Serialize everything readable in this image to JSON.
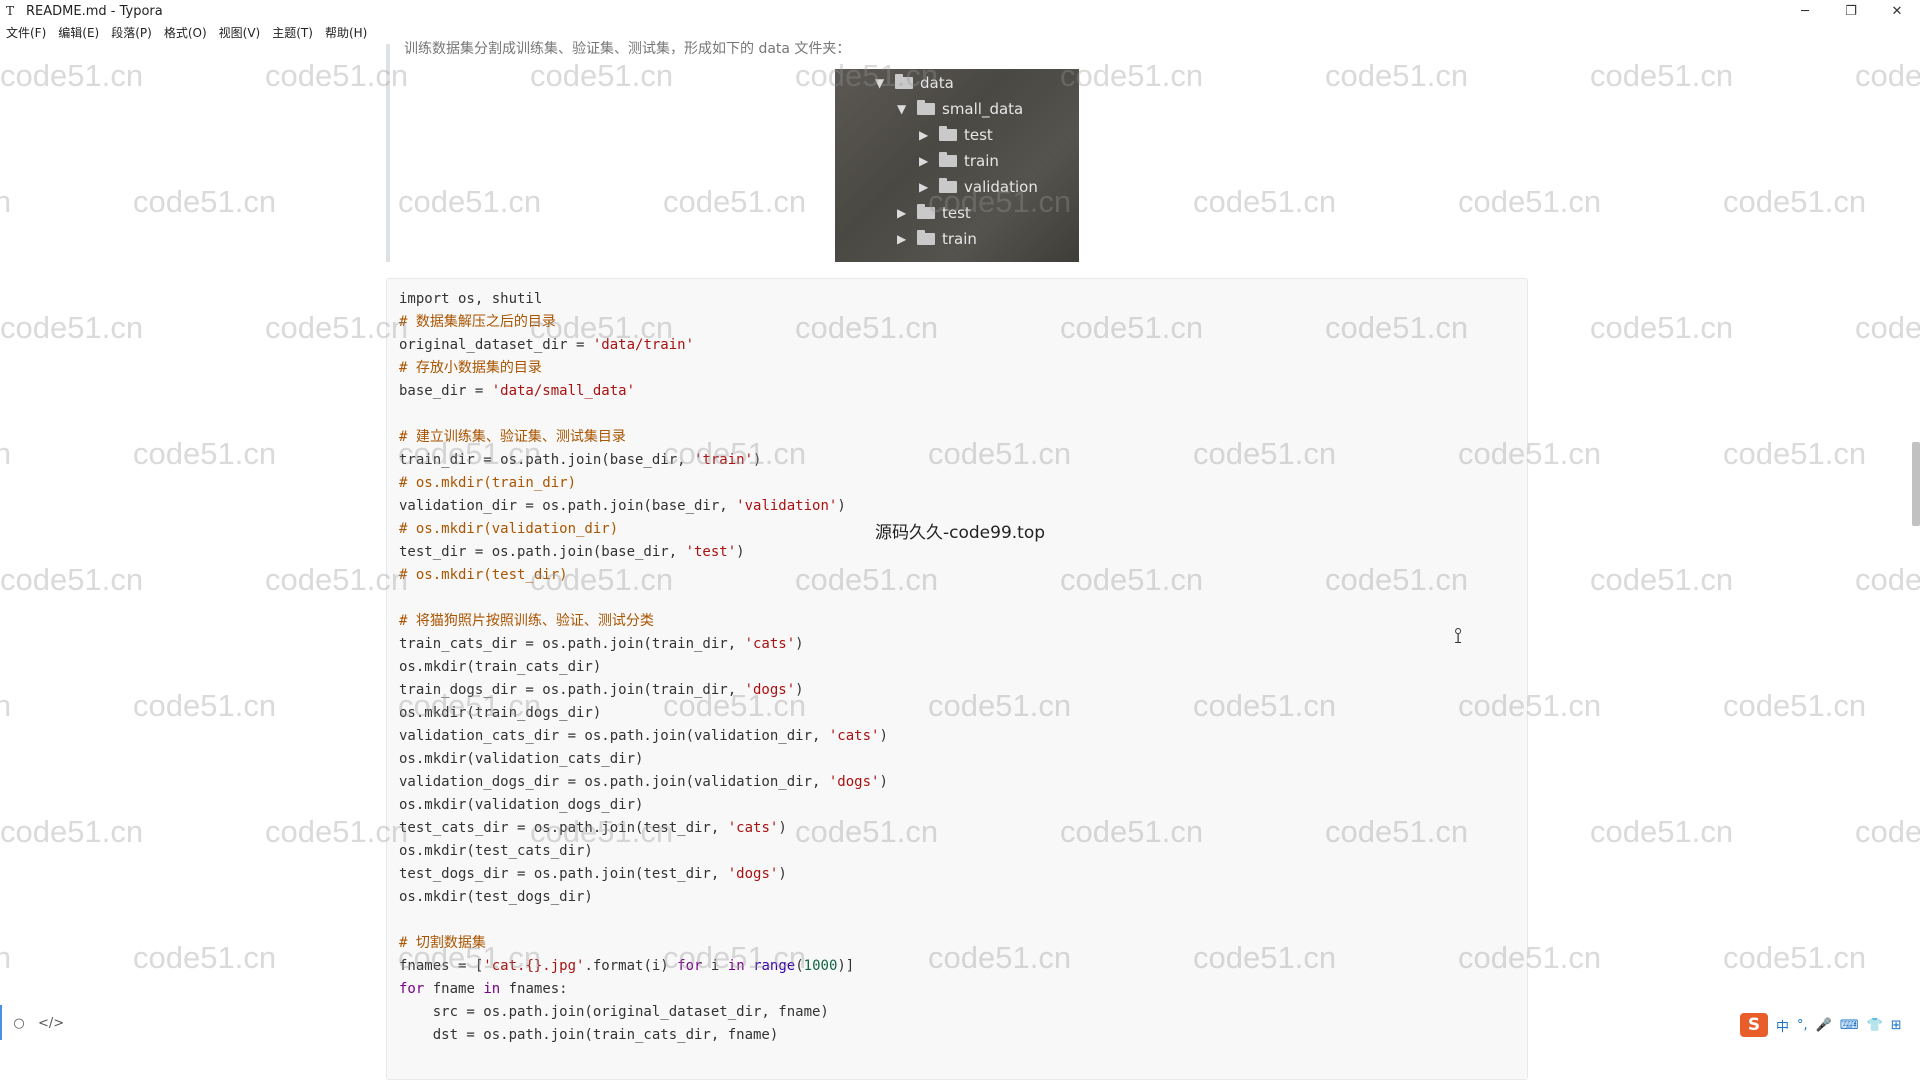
{
  "window": {
    "app_logo": "T",
    "title": "README.md - Typora",
    "minimize": "─",
    "restore": "❐",
    "close": "✕"
  },
  "menu": [
    "文件(F)",
    "编辑(E)",
    "段落(P)",
    "格式(O)",
    "视图(V)",
    "主题(T)",
    "帮助(H)"
  ],
  "quote_text": "训练数据集分割成训练集、验证集、测试集，形成如下的 data 文件夹：",
  "tree": [
    {
      "arrow": "▼",
      "label": "data"
    },
    {
      "arrow": "▼",
      "label": "small_data"
    },
    {
      "arrow": "▶",
      "label": "test"
    },
    {
      "arrow": "▶",
      "label": "train"
    },
    {
      "arrow": "▶",
      "label": "validation"
    },
    {
      "arrow": "▶",
      "label": "test"
    },
    {
      "arrow": "▶",
      "label": "train"
    }
  ],
  "code_lines": [
    [
      {
        "t": "import os, shutil",
        "c": ""
      }
    ],
    [
      {
        "t": "# 数据集解压之后的目录",
        "c": "c-comment"
      }
    ],
    [
      {
        "t": "original_dataset_dir = ",
        "c": ""
      },
      {
        "t": "'data/train'",
        "c": "c-string"
      }
    ],
    [
      {
        "t": "# 存放小数据集的目录",
        "c": "c-comment"
      }
    ],
    [
      {
        "t": "base_dir = ",
        "c": ""
      },
      {
        "t": "'data/small_data'",
        "c": "c-string"
      }
    ],
    [
      {
        "t": "",
        "c": ""
      }
    ],
    [
      {
        "t": "# 建立训练集、验证集、测试集目录",
        "c": "c-comment"
      }
    ],
    [
      {
        "t": "train_dir = os.path.join(base_dir, ",
        "c": ""
      },
      {
        "t": "'train'",
        "c": "c-string"
      },
      {
        "t": ")",
        "c": ""
      }
    ],
    [
      {
        "t": "# os.mkdir(train_dir)",
        "c": "c-comment"
      }
    ],
    [
      {
        "t": "validation_dir = os.path.join(base_dir, ",
        "c": ""
      },
      {
        "t": "'validation'",
        "c": "c-string"
      },
      {
        "t": ")",
        "c": ""
      }
    ],
    [
      {
        "t": "# os.mkdir(validation_dir)",
        "c": "c-comment"
      }
    ],
    [
      {
        "t": "test_dir = os.path.join(base_dir, ",
        "c": ""
      },
      {
        "t": "'test'",
        "c": "c-string"
      },
      {
        "t": ")",
        "c": ""
      }
    ],
    [
      {
        "t": "# os.mkdir(test_dir)",
        "c": "c-comment"
      }
    ],
    [
      {
        "t": "",
        "c": ""
      }
    ],
    [
      {
        "t": "# 将猫狗照片按照训练、验证、测试分类",
        "c": "c-comment"
      }
    ],
    [
      {
        "t": "train_cats_dir = os.path.join(train_dir, ",
        "c": ""
      },
      {
        "t": "'cats'",
        "c": "c-string"
      },
      {
        "t": ")",
        "c": ""
      }
    ],
    [
      {
        "t": "os.mkdir(train_cats_dir)",
        "c": ""
      }
    ],
    [
      {
        "t": "train_dogs_dir = os.path.join(train_dir, ",
        "c": ""
      },
      {
        "t": "'dogs'",
        "c": "c-string"
      },
      {
        "t": ")",
        "c": ""
      }
    ],
    [
      {
        "t": "os.mkdir(train_dogs_dir)",
        "c": ""
      }
    ],
    [
      {
        "t": "validation_cats_dir = os.path.join(validation_dir, ",
        "c": ""
      },
      {
        "t": "'cats'",
        "c": "c-string"
      },
      {
        "t": ")",
        "c": ""
      }
    ],
    [
      {
        "t": "os.mkdir(validation_cats_dir)",
        "c": ""
      }
    ],
    [
      {
        "t": "validation_dogs_dir = os.path.join(validation_dir, ",
        "c": ""
      },
      {
        "t": "'dogs'",
        "c": "c-string"
      },
      {
        "t": ")",
        "c": ""
      }
    ],
    [
      {
        "t": "os.mkdir(validation_dogs_dir)",
        "c": ""
      }
    ],
    [
      {
        "t": "test_cats_dir = os.path.join(test_dir, ",
        "c": ""
      },
      {
        "t": "'cats'",
        "c": "c-string"
      },
      {
        "t": ")",
        "c": ""
      }
    ],
    [
      {
        "t": "os.mkdir(test_cats_dir)",
        "c": ""
      }
    ],
    [
      {
        "t": "test_dogs_dir = os.path.join(test_dir, ",
        "c": ""
      },
      {
        "t": "'dogs'",
        "c": "c-string"
      },
      {
        "t": ")",
        "c": ""
      }
    ],
    [
      {
        "t": "os.mkdir(test_dogs_dir)",
        "c": ""
      }
    ],
    [
      {
        "t": "",
        "c": ""
      }
    ],
    [
      {
        "t": "# 切割数据集",
        "c": "c-comment"
      }
    ],
    [
      {
        "t": "fnames = [",
        "c": ""
      },
      {
        "t": "'cat.{}.jpg'",
        "c": "c-string"
      },
      {
        "t": ".format(i) ",
        "c": ""
      },
      {
        "t": "for",
        "c": "c-keyword"
      },
      {
        "t": " i ",
        "c": ""
      },
      {
        "t": "in",
        "c": "c-keyword"
      },
      {
        "t": " ",
        "c": ""
      },
      {
        "t": "range",
        "c": "c-builtin"
      },
      {
        "t": "(",
        "c": ""
      },
      {
        "t": "1000",
        "c": "c-number"
      },
      {
        "t": ")]",
        "c": ""
      }
    ],
    [
      {
        "t": "for",
        "c": "c-keyword"
      },
      {
        "t": " fname ",
        "c": ""
      },
      {
        "t": "in",
        "c": "c-keyword"
      },
      {
        "t": " fnames:",
        "c": ""
      }
    ],
    [
      {
        "t": "    src = os.path.join(original_dataset_dir, fname)",
        "c": ""
      }
    ],
    [
      {
        "t": "    dst = os.path.join(train_cats_dir, fname)",
        "c": ""
      }
    ]
  ],
  "watermark_text": "code51.cn",
  "center_watermark": "源码久久-code99.top",
  "cursor_icon": "⟟",
  "bottom": {
    "outline_icon": "○",
    "source_icon": "</>"
  },
  "ime": {
    "logo": "S",
    "items": [
      "中",
      "°,",
      "🎤",
      "⌨",
      "👕",
      "⊞"
    ]
  }
}
